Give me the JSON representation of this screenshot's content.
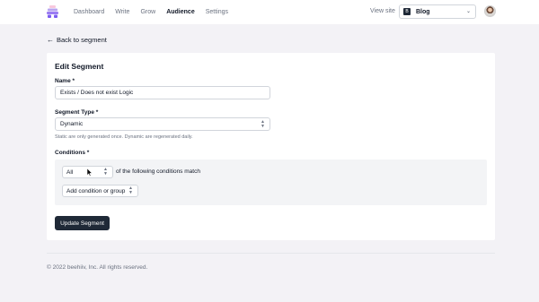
{
  "nav": {
    "items": [
      "Dashboard",
      "Write",
      "Grow",
      "Audience",
      "Settings"
    ],
    "active": "Audience",
    "view_site": "View site",
    "publication": "Blog",
    "publication_icon": "B"
  },
  "back_link": "Back to segment",
  "form": {
    "title": "Edit Segment",
    "name_label": "Name *",
    "name_value": "Exists / Does not exist Logic",
    "type_label": "Segment Type *",
    "type_value": "Dynamic",
    "type_hint": "Static are only generated once. Dynamic are regenerated daily.",
    "conditions_label": "Conditions *",
    "match_value": "All",
    "match_text": "of the following conditions match",
    "add_condition": "Add condition or group",
    "submit": "Update Segment"
  },
  "footer": "© 2022 beehiiv, Inc. All rights reserved.",
  "colors": {
    "logo_top": "#f8c8dd",
    "logo_mid": "#b8a4f0",
    "logo_bottom": "#7b5cf0",
    "button": "#1f2937",
    "background": "#f3f2f6"
  }
}
